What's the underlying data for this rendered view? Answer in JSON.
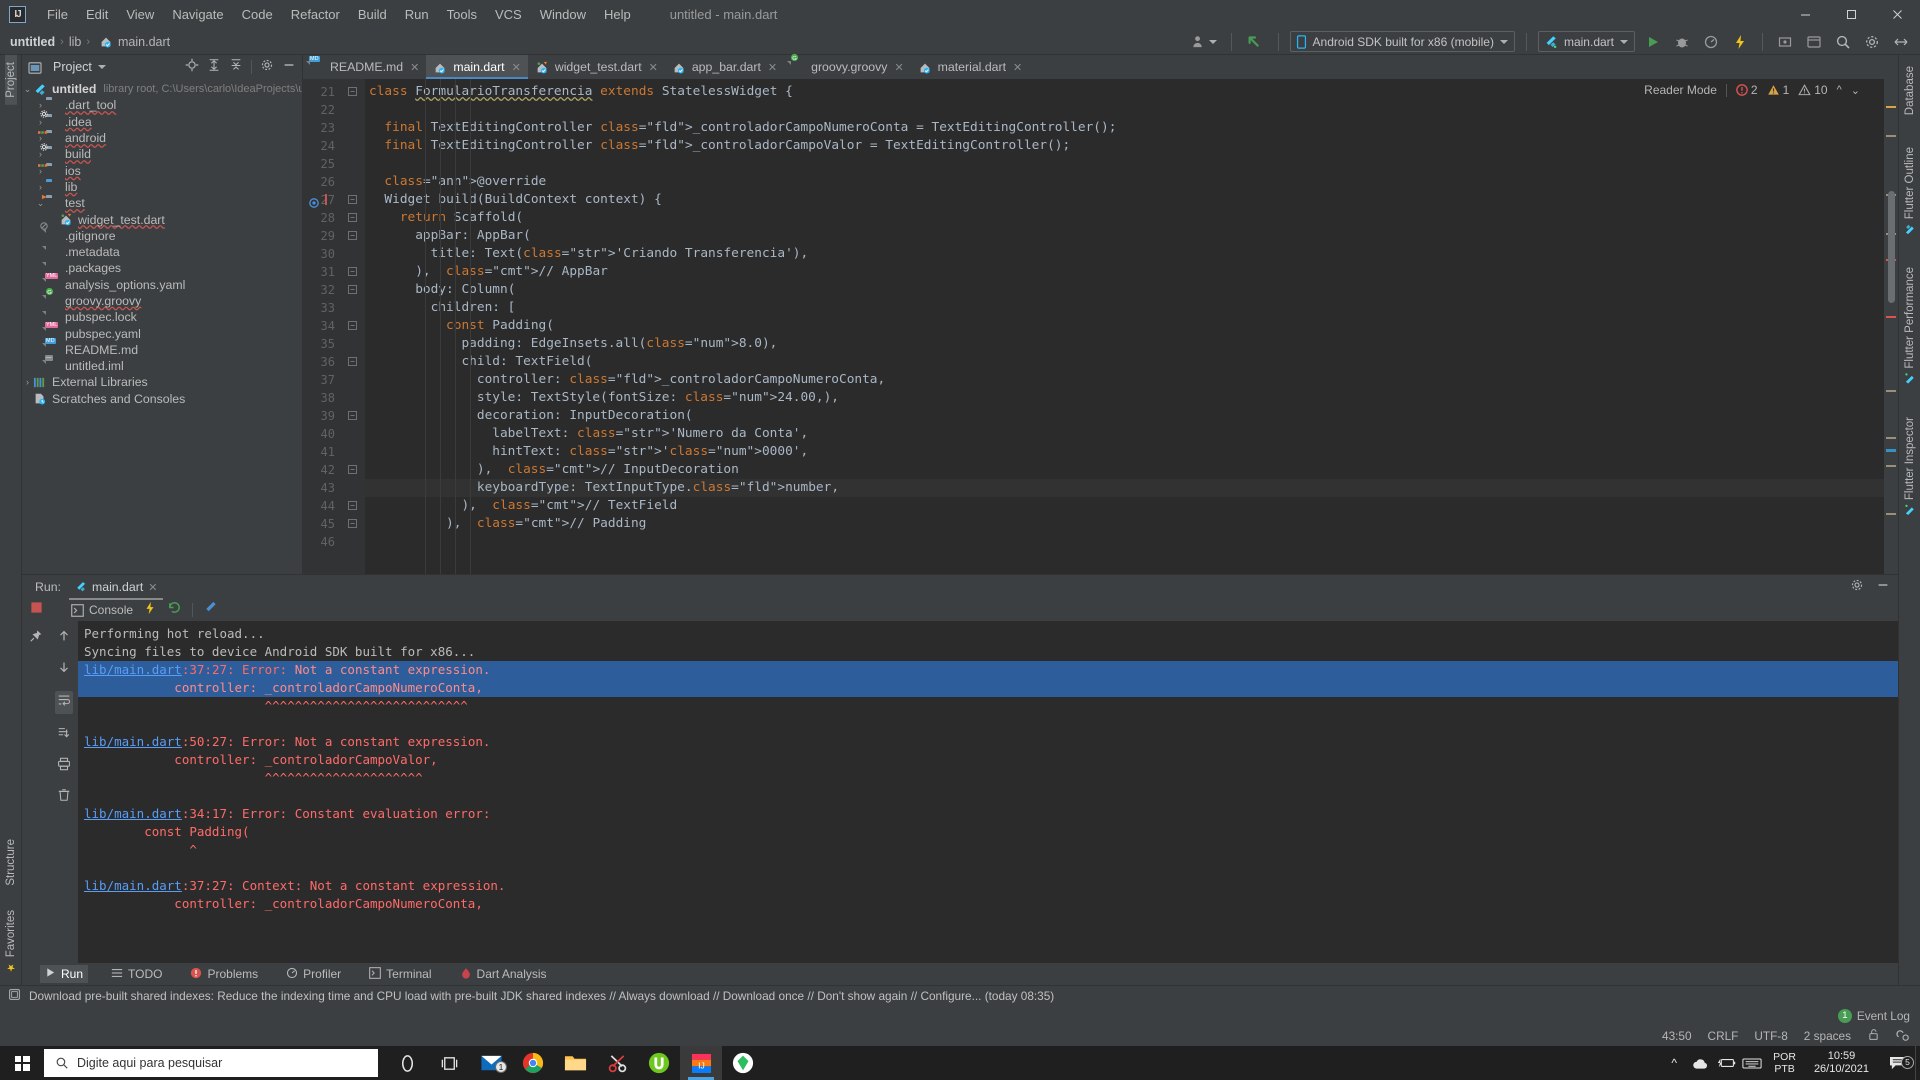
{
  "titlebar": {
    "logo": "IJ",
    "menu": [
      "File",
      "Edit",
      "View",
      "Navigate",
      "Code",
      "Refactor",
      "Build",
      "Run",
      "Tools",
      "VCS",
      "Window",
      "Help"
    ],
    "window_title": "untitled - main.dart",
    "minimize": "–",
    "maximize": "☐",
    "close": "✕"
  },
  "navbar": {
    "crumbs": [
      "untitled",
      "lib",
      "main.dart"
    ],
    "device": "Android SDK built for x86 (mobile)",
    "run_config": "main.dart"
  },
  "project_panel": {
    "title": "Project",
    "root": {
      "label": "untitled",
      "meta": "library root,  C:\\Users\\carlo\\IdeaProjects\\untitled"
    },
    "items": [
      {
        "label": ".dart_tool",
        "type": "folder",
        "indent": 1,
        "arrow": "›"
      },
      {
        "label": ".idea",
        "type": "folder-gear",
        "indent": 1,
        "arrow": "›"
      },
      {
        "label": "android",
        "type": "folder-src",
        "indent": 1,
        "arrow": "›"
      },
      {
        "label": "build",
        "type": "folder-gear",
        "indent": 1,
        "arrow": "›"
      },
      {
        "label": "ios",
        "type": "folder-src",
        "indent": 1,
        "arrow": "›"
      },
      {
        "label": "lib",
        "type": "folder-blue",
        "indent": 1,
        "arrow": "›"
      },
      {
        "label": "test",
        "type": "folder-test",
        "indent": 1,
        "arrow": "∨"
      },
      {
        "label": "widget_test.dart",
        "type": "dart-test",
        "indent": 2,
        "arrow": ""
      },
      {
        "label": ".gitignore",
        "type": "file-git",
        "indent": 1,
        "arrow": ""
      },
      {
        "label": ".metadata",
        "type": "file",
        "indent": 1,
        "arrow": ""
      },
      {
        "label": ".packages",
        "type": "file",
        "indent": 1,
        "arrow": ""
      },
      {
        "label": "analysis_options.yaml",
        "type": "yml",
        "indent": 1,
        "arrow": ""
      },
      {
        "label": "groovy.groovy",
        "type": "groovy",
        "indent": 1,
        "arrow": ""
      },
      {
        "label": "pubspec.lock",
        "type": "file",
        "indent": 1,
        "arrow": ""
      },
      {
        "label": "pubspec.yaml",
        "type": "yml",
        "indent": 1,
        "arrow": ""
      },
      {
        "label": "README.md",
        "type": "md",
        "indent": 1,
        "arrow": ""
      },
      {
        "label": "untitled.iml",
        "type": "iml",
        "indent": 1,
        "arrow": ""
      }
    ],
    "external_libraries": "External Libraries",
    "scratches": "Scratches and Consoles"
  },
  "editor": {
    "tabs": [
      {
        "label": "README.md",
        "icon": "md",
        "active": false
      },
      {
        "label": "main.dart",
        "icon": "dart",
        "active": true
      },
      {
        "label": "widget_test.dart",
        "icon": "dart-test",
        "active": false
      },
      {
        "label": "app_bar.dart",
        "icon": "dart",
        "active": false
      },
      {
        "label": "groovy.groovy",
        "icon": "groovy",
        "active": false
      },
      {
        "label": "material.dart",
        "icon": "dart",
        "active": false
      }
    ],
    "reader_mode": "Reader Mode",
    "inspections": {
      "errors": "2",
      "warnings": "1",
      "weak_warnings": "10"
    },
    "first_line_number": 21,
    "current_line": 43,
    "lines": [
      {
        "n": 21,
        "fold": "minus"
      },
      {
        "n": 22,
        "fold": ""
      },
      {
        "n": 23,
        "fold": ""
      },
      {
        "n": 24,
        "fold": ""
      },
      {
        "n": 25,
        "fold": ""
      },
      {
        "n": 26,
        "fold": ""
      },
      {
        "n": 27,
        "fold": "minus",
        "marker": "override"
      },
      {
        "n": 28,
        "fold": "minus"
      },
      {
        "n": 29,
        "fold": "minus"
      },
      {
        "n": 30,
        "fold": ""
      },
      {
        "n": 31,
        "fold": "collapse"
      },
      {
        "n": 32,
        "fold": "minus"
      },
      {
        "n": 33,
        "fold": ""
      },
      {
        "n": 34,
        "fold": "minus"
      },
      {
        "n": 35,
        "fold": ""
      },
      {
        "n": 36,
        "fold": "minus"
      },
      {
        "n": 37,
        "fold": ""
      },
      {
        "n": 38,
        "fold": ""
      },
      {
        "n": 39,
        "fold": "minus"
      },
      {
        "n": 40,
        "fold": ""
      },
      {
        "n": 41,
        "fold": ""
      },
      {
        "n": 42,
        "fold": "collapse"
      },
      {
        "n": 43,
        "fold": ""
      },
      {
        "n": 44,
        "fold": "collapse"
      },
      {
        "n": 45,
        "fold": "collapse"
      },
      {
        "n": 46,
        "fold": ""
      }
    ],
    "code_text": [
      "class FormularioTransferencia extends StatelessWidget {",
      "",
      "  final TextEditingController _controladorCampoNumeroConta = TextEditingController();",
      "  final TextEditingController _controladorCampoValor = TextEditingController();",
      "",
      "  @override",
      "  Widget build(BuildContext context) {",
      "    return Scaffold(",
      "      appBar: AppBar(",
      "        title: Text('Criando Transferencia'),",
      "      ),  // AppBar",
      "      body: Column(",
      "        children: [",
      "          const Padding(",
      "            padding: EdgeInsets.all(8.0),",
      "            child: TextField(",
      "              controller: _controladorCampoNumeroConta,",
      "              style: TextStyle(fontSize: 24.00,),",
      "              decoration: InputDecoration(",
      "                labelText: 'Numero da Conta',",
      "                hintText: '0000',",
      "              ),  // InputDecoration",
      "              keyboardType: TextInputType.number,",
      "            ),  // TextField",
      "          ),  // Padding",
      ""
    ]
  },
  "right_rail": [
    {
      "label": "Database",
      "icon": "database-icon"
    },
    {
      "label": "Flutter Outline",
      "icon": "flutter-icon"
    },
    {
      "label": "Flutter Performance",
      "icon": "flutter-icon"
    },
    {
      "label": "Flutter Inspector",
      "icon": "flutter-icon"
    }
  ],
  "left_rail": [
    {
      "label": "Project",
      "icon": "project-icon",
      "active": true
    },
    {
      "label": "Structure",
      "icon": "structure-icon",
      "active": false
    },
    {
      "label": "Favorites",
      "icon": "star-icon",
      "active": false
    }
  ],
  "run_panel": {
    "run_label": "Run:",
    "tab_label": "main.dart",
    "console_label": "Console",
    "lines": [
      {
        "text": "Performing hot reload...",
        "kind": "plain"
      },
      {
        "text": "Syncing files to device Android SDK built for x86...",
        "kind": "plain"
      },
      {
        "link": "lib/main.dart",
        "rest": ":37:27: Error: ",
        "highlight": "Not a constant expression.",
        "kind": "error-link-sel"
      },
      {
        "text": "            controller: _controladorCampoNumeroConta,",
        "kind": "error-sel"
      },
      {
        "text": "                        ^^^^^^^^^^^^^^^^^^^^^^^^^^^",
        "kind": "error"
      },
      {
        "text": "",
        "kind": "plain"
      },
      {
        "link": "lib/main.dart",
        "rest": ":50:27: Error: Not a constant expression.",
        "kind": "error-link"
      },
      {
        "text": "            controller: _controladorCampoValor,",
        "kind": "error"
      },
      {
        "text": "                        ^^^^^^^^^^^^^^^^^^^^^",
        "kind": "error"
      },
      {
        "text": "",
        "kind": "plain"
      },
      {
        "link": "lib/main.dart",
        "rest": ":34:17: Error: Constant evaluation error:",
        "kind": "error-link"
      },
      {
        "text": "        const Padding(",
        "kind": "error"
      },
      {
        "text": "              ^",
        "kind": "error"
      },
      {
        "text": "",
        "kind": "plain"
      },
      {
        "link": "lib/main.dart",
        "rest": ":37:27: Context: Not a constant expression.",
        "kind": "error-link"
      },
      {
        "text": "            controller: _controladorCampoNumeroConta,",
        "kind": "error"
      }
    ]
  },
  "toolwindows": [
    {
      "label": "Run",
      "icon": "play-icon",
      "active": true
    },
    {
      "label": "TODO",
      "icon": "list-icon",
      "active": false
    },
    {
      "label": "Problems",
      "icon": "error-icon",
      "active": false
    },
    {
      "label": "Profiler",
      "icon": "profiler-icon",
      "active": false
    },
    {
      "label": "Terminal",
      "icon": "terminal-icon",
      "active": false
    },
    {
      "label": "Dart Analysis",
      "icon": "dart-icon",
      "active": false
    }
  ],
  "notification": "Download pre-built shared indexes: Reduce the indexing time and CPU load with pre-built JDK shared indexes // Always download // Download once // Don't show again // Configure... (today 08:35)",
  "statusbar": {
    "event_log": "Event Log",
    "event_count": "1",
    "caret": "43:50",
    "line_sep": "CRLF",
    "encoding": "UTF-8",
    "indent": "2 spaces"
  },
  "taskbar": {
    "search_placeholder": "Digite aqui para pesquisar",
    "lang_top": "POR",
    "lang_bottom": "PTB",
    "time": "10:59",
    "date": "26/10/2021",
    "notif_count": "5",
    "mail_badge": "1",
    "apps": [
      "cortana-icon",
      "task-view-icon",
      "mail-icon",
      "chrome-icon",
      "explorer-icon",
      "snip-icon",
      "utorrent-icon",
      "intellij-icon",
      "evernote-icon"
    ]
  },
  "colors": {
    "accent_blue": "#4a88c7",
    "error_red": "#ff6b68",
    "link_blue": "#589df6",
    "selection_blue": "#2e5d9b",
    "string_green": "#6a8759",
    "keyword_orange": "#cc7832"
  }
}
